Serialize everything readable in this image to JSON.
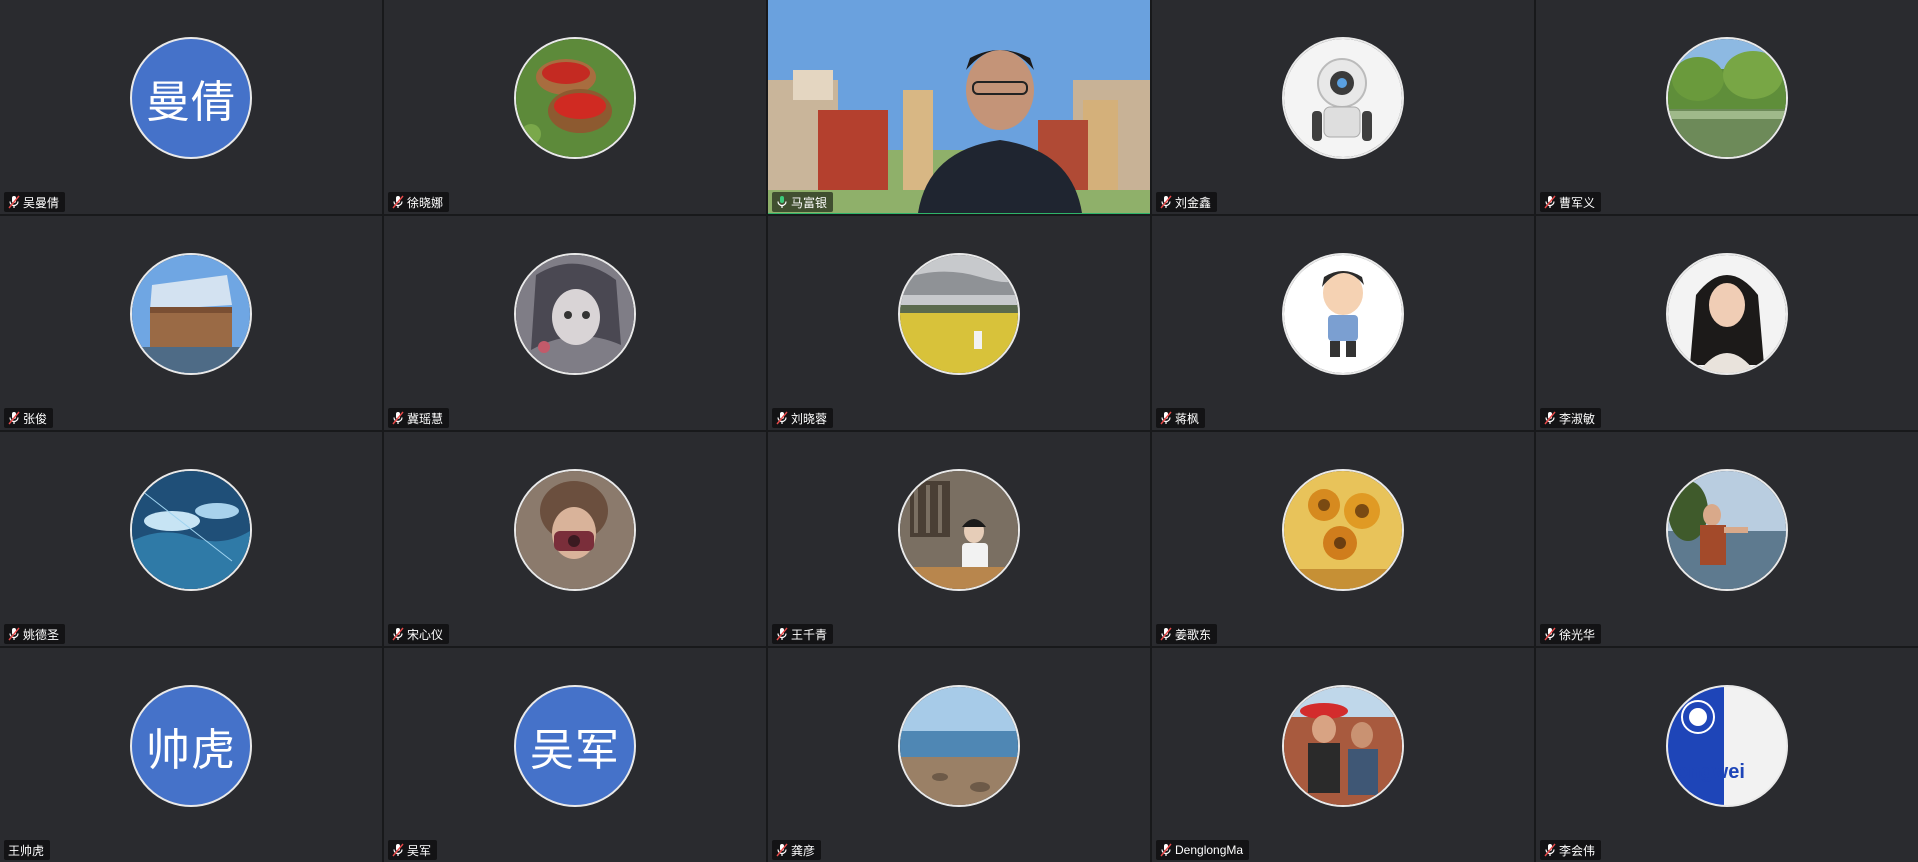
{
  "meeting": {
    "participants": [
      {
        "name": "吴曼倩",
        "avatar_text": "曼倩",
        "avatar_style": "initials",
        "mic": "muted"
      },
      {
        "name": "徐晓娜",
        "avatar_style": "photo",
        "avatar_icon": "basket-photo-icon",
        "mic": "muted"
      },
      {
        "name": "马富银",
        "avatar_style": "video",
        "mic": "active",
        "active_speaker": true
      },
      {
        "name": "刘金鑫",
        "avatar_style": "photo",
        "avatar_icon": "robot-photo-icon",
        "mic": "muted"
      },
      {
        "name": "曹军义",
        "avatar_style": "photo",
        "avatar_icon": "lake-photo-icon",
        "mic": "muted"
      },
      {
        "name": "张俊",
        "avatar_style": "photo",
        "avatar_icon": "building-photo-icon",
        "mic": "muted"
      },
      {
        "name": "冀瑶慧",
        "avatar_style": "photo",
        "avatar_icon": "anime-girl-photo-icon",
        "mic": "muted"
      },
      {
        "name": "刘晓蓉",
        "avatar_style": "photo",
        "avatar_icon": "field-photo-icon",
        "mic": "muted"
      },
      {
        "name": "蒋枫",
        "avatar_style": "photo",
        "avatar_icon": "cartoon-man-photo-icon",
        "mic": "muted"
      },
      {
        "name": "李淑敏",
        "avatar_style": "photo",
        "avatar_icon": "woman-portrait-photo-icon",
        "mic": "muted"
      },
      {
        "name": "姚德圣",
        "avatar_style": "photo",
        "avatar_icon": "sky-illustration-photo-icon",
        "mic": "muted"
      },
      {
        "name": "宋心仪",
        "avatar_style": "photo",
        "avatar_icon": "camera-girl-photo-icon",
        "mic": "muted"
      },
      {
        "name": "王千青",
        "avatar_style": "photo",
        "avatar_icon": "girl-seated-photo-icon",
        "mic": "muted"
      },
      {
        "name": "姜歌东",
        "avatar_style": "photo",
        "avatar_icon": "sunflowers-photo-icon",
        "mic": "muted"
      },
      {
        "name": "徐光华",
        "avatar_style": "photo",
        "avatar_icon": "hiker-photo-icon",
        "mic": "muted"
      },
      {
        "name": "王帅虎",
        "avatar_text": "帅虎",
        "avatar_style": "initials",
        "mic": "none"
      },
      {
        "name": "吴军",
        "avatar_text": "吴军",
        "avatar_style": "initials",
        "mic": "muted"
      },
      {
        "name": "龚彦",
        "avatar_style": "photo",
        "avatar_icon": "beach-photo-icon",
        "mic": "muted"
      },
      {
        "name": "DenglongMa",
        "avatar_style": "photo",
        "avatar_icon": "two-men-photo-icon",
        "mic": "muted"
      },
      {
        "name": "李会伟",
        "avatar_style": "photo",
        "avatar_icon": "logo-photo-icon",
        "avatar_logo_text": "ongwei",
        "mic": "muted"
      }
    ]
  },
  "colors": {
    "tile_bg": "#2a2b2f",
    "initials_bg": "#4572c9",
    "active_speaker_border": "#2fb36a",
    "name_tag_bg": "rgba(0,0,0,0.55)"
  }
}
